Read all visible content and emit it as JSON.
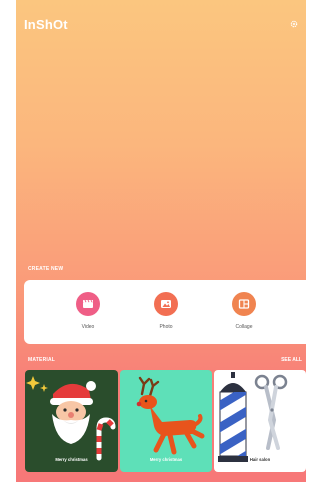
{
  "app": {
    "logo": "InShOt"
  },
  "header": {
    "settings_icon": "gear-icon"
  },
  "create_new": {
    "title": "CREATE NEW",
    "items": [
      {
        "label": "Video",
        "icon": "video-clapper-icon",
        "color": "#ef5e86"
      },
      {
        "label": "Photo",
        "icon": "photo-icon",
        "color": "#f26f53"
      },
      {
        "label": "Collage",
        "icon": "collage-icon",
        "color": "#f08450"
      }
    ]
  },
  "material": {
    "title": "MATERIAL",
    "see_all": "SEE ALL",
    "tiles": [
      {
        "label": "Merry christmas",
        "background": "#2a4d2c",
        "art": "santa-claus-icon"
      },
      {
        "label": "Merry christmas",
        "background": "#5ee0b8",
        "art": "reindeer-icon"
      },
      {
        "label": "Hair salon",
        "background": "#ffffff",
        "art": "barber-pole-scissors-icon"
      }
    ]
  },
  "colors": {
    "gradient_top": "#fbc67f",
    "gradient_bottom": "#f77878"
  }
}
